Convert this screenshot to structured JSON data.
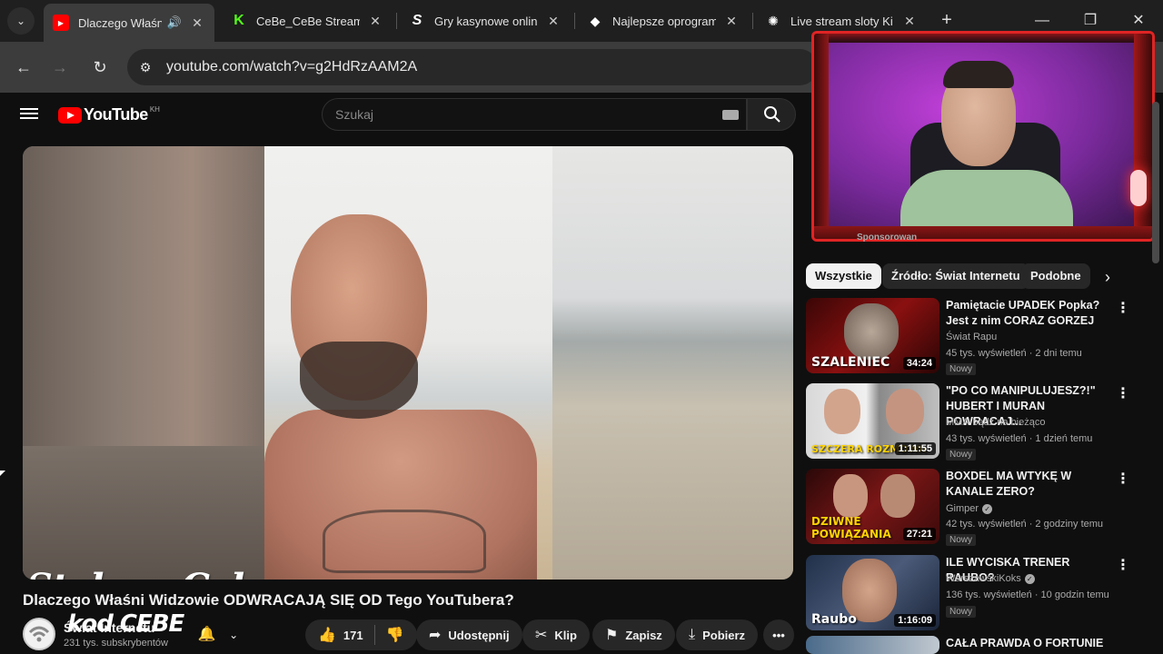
{
  "browser": {
    "tabs": [
      {
        "title": "Dlaczego Właśn",
        "favicon": "youtube-icon",
        "active": true
      },
      {
        "title": "CeBe_CeBe Stream",
        "favicon": "kick-icon"
      },
      {
        "title": "Gry kasynowe onlin",
        "favicon": "s-logo-icon"
      },
      {
        "title": "Najlepsze oprogram",
        "favicon": "diamond-icon"
      },
      {
        "title": "Live stream sloty Ki",
        "favicon": "chatgpt-icon"
      }
    ],
    "url": "youtube.com/watch?v=g2HdRzAAM2A"
  },
  "youtube": {
    "logo_text": "YouTube",
    "country_code": "KH",
    "search_placeholder": "Szukaj"
  },
  "video": {
    "title": "Dlaczego Właśni Widzowie ODWRACAJĄ SIĘ OD Tego YouTubera?",
    "channel_name": "Świat Internetu",
    "subscribers": "231 tys. subskrybentów",
    "likes": "171",
    "share_label": "Udostępnij",
    "clip_label": "Klip",
    "save_label": "Zapisz",
    "download_label": "Pobierz",
    "watermark_line1": "Stake x Cebe",
    "watermark_line2": "kod CEBE"
  },
  "sidebar": {
    "sponsored_label": "Sponsorowan",
    "chips": [
      "Wszystkie",
      "Źródło: Świat Internetu",
      "Podobne"
    ],
    "recommendations": [
      {
        "title": "Pamiętacie UPADEK Popka? Jest z nim CORAZ GORZEJ",
        "channel": "Świat Rapu",
        "meta": "45 tys. wyświetleń · 2 dni temu",
        "badge": "Nowy",
        "duration": "34:24",
        "thumb_text": "SZALENIEC",
        "verified": false
      },
      {
        "title": "\"PO CO MANIPULUJESZ?!\" HUBERT I MURAN POWRACAJ...",
        "channel": "MMA-bądź na bieżąco",
        "meta": "43 tys. wyświetleń · 1 dzień temu",
        "badge": "Nowy",
        "duration": "1:11:55",
        "thumb_text": "SZCZERA ROZMOWA",
        "verified": false
      },
      {
        "title": "BOXDEL MA WTYKĘ W KANALE ZERO?",
        "channel": "Gimper",
        "meta": "42 tys. wyświetleń · 2 godziny temu",
        "badge": "Nowy",
        "duration": "27:21",
        "thumb_text": "DZIWNE POWIĄZANIA",
        "verified": true
      },
      {
        "title": "ILE WYCISKA TRENER RAUBO?",
        "channel": "WarszawskiKoks",
        "meta": "136 tys. wyświetleń · 10 godzin temu",
        "badge": "Nowy",
        "duration": "1:16:09",
        "thumb_text": "Raubo",
        "verified": true
      },
      {
        "title": "CAŁA PRAWDA O FORTUNIE",
        "channel": "",
        "meta": "",
        "badge": "",
        "duration": "",
        "thumb_text": "",
        "verified": false
      }
    ]
  },
  "colors": {
    "youtube_red": "#ff0000",
    "background": "#0f0f0f",
    "cam_border": "#e02424"
  }
}
